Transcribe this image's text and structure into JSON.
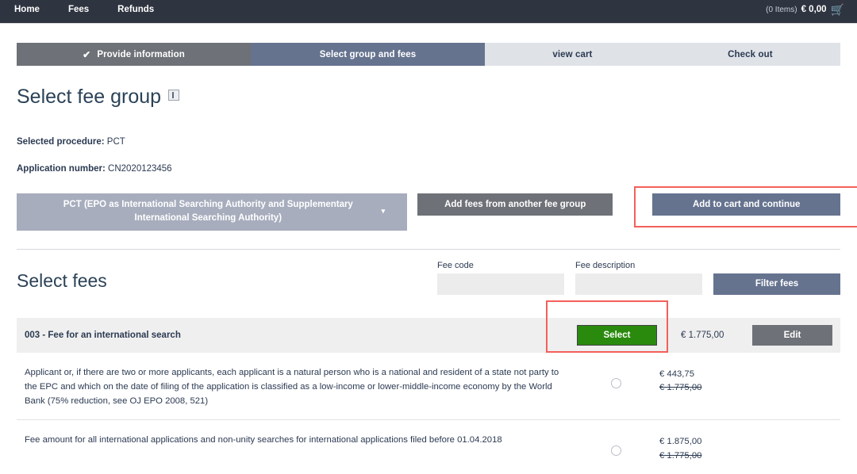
{
  "topnav": {
    "items": [
      {
        "label": "Home"
      },
      {
        "label": "Fees"
      },
      {
        "label": "Refunds"
      }
    ],
    "cart_items": "(0 Items)",
    "cart_total": "€ 0,00",
    "cart_icon": "shopping-cart-icon"
  },
  "steps": [
    {
      "label": "Provide information",
      "state": "done",
      "check": "✔"
    },
    {
      "label": "Select group and fees",
      "state": "current"
    },
    {
      "label": "view cart",
      "state": "todo"
    },
    {
      "label": "Check out",
      "state": "todo"
    }
  ],
  "page": {
    "title": "Select fee group",
    "title_info_icon": "info-icon",
    "procedure_label": "Selected procedure:",
    "procedure_value": "PCT",
    "application_label": "Application number:",
    "application_value": "CN2020123456"
  },
  "group_row": {
    "group_button": "PCT (EPO as International Searching Authority and Supplementary International Searching Authority)",
    "group_caret": "▾",
    "another_group_button": "Add fees from another fee group",
    "add_to_cart_button": "Add to cart and continue"
  },
  "fees_section": {
    "title": "Select fees",
    "fee_code_label": "Fee code",
    "fee_code_value": "",
    "fee_code_placeholder": "",
    "fee_description_label": "Fee description",
    "fee_description_value": "",
    "fee_description_placeholder": "",
    "filter_button": "Filter fees"
  },
  "fee_row": {
    "label": "003 - Fee for an international search",
    "select_button": "Select",
    "price": "€ 1.775,00",
    "edit_button": "Edit"
  },
  "subfees": [
    {
      "description": "Applicant or, if there are two or more applicants, each applicant is a natural person who is a national and resident of a state not party to the EPC and which on the date of filing of the application is classified as a low-income or lower-middle-income economy by the World Bank (75% reduction, see OJ EPO 2008, 521)",
      "price": "€ 443,75",
      "old_price": "€ 1.775,00",
      "selected": false
    },
    {
      "description": "Fee amount for all international applications and non-unity searches for international applications filed before 01.04.2018",
      "price": "€ 1.875,00",
      "old_price": "€ 1.775,00",
      "selected": false
    }
  ],
  "colors": {
    "navbar": "#2e3440",
    "step_done": "#6e7177",
    "step_current": "#66738f",
    "step_todo": "#dfe2e7",
    "accent_blue": "#66738f",
    "select_green": "#2a8a0e",
    "highlight_red": "#f4605a",
    "row_bg": "#efefef"
  }
}
